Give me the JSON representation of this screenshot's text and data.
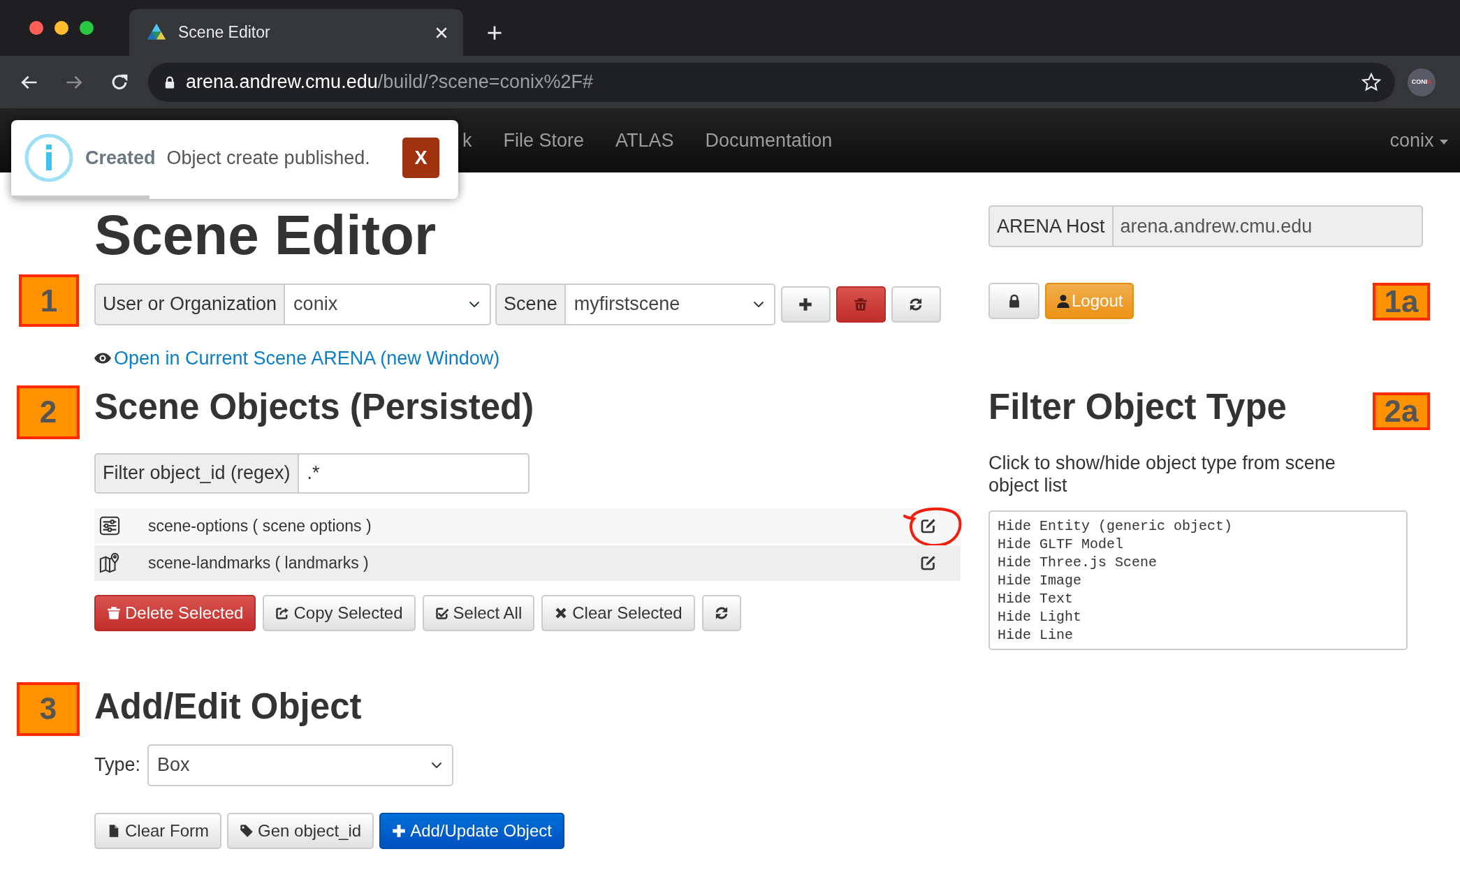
{
  "browser": {
    "tab_title": "Scene Editor",
    "url_host": "arena.andrew.cmu.edu",
    "url_path": "/build/?scene=conix%2F#",
    "avatar_text": "CONI",
    "avatar_accent": "X"
  },
  "navbar": {
    "items": [
      {
        "label": "k"
      },
      {
        "label": "File Store"
      },
      {
        "label": "ATLAS"
      },
      {
        "label": "Documentation"
      }
    ],
    "user": "conix"
  },
  "toast": {
    "title": "Created",
    "message": "Object create published.",
    "close": "X",
    "level": 0.31
  },
  "page_title": "Scene Editor",
  "scene_selector": {
    "marker": "1",
    "user_label": "User or Organization",
    "user_value": "conix",
    "scene_label": "Scene",
    "scene_value": "myfirstscene"
  },
  "host": {
    "label": "ARENA Host",
    "value": "arena.andrew.cmu.edu",
    "disabled": true
  },
  "account": {
    "marker": "1a",
    "logout": "Logout"
  },
  "open_link": "Open in Current Scene ARENA (new Window)",
  "scene_objects": {
    "marker": "2",
    "heading": "Scene Objects (Persisted)",
    "filter_label": "Filter object_id (regex)",
    "filter_value": ".*",
    "objects": [
      {
        "kind": "options",
        "label": "scene-options ( scene options )",
        "annotated": true
      },
      {
        "kind": "landmarks",
        "label": "scene-landmarks ( landmarks )",
        "annotated": false
      }
    ],
    "buttons": [
      {
        "kind": "delete",
        "label": "Delete Selected"
      },
      {
        "kind": "copy",
        "label": "Copy Selected"
      },
      {
        "kind": "select",
        "label": "Select All"
      },
      {
        "kind": "clear",
        "label": "Clear Selected"
      },
      {
        "kind": "refresh"
      }
    ]
  },
  "filter_types": {
    "marker": "2a",
    "heading": "Filter Object Type",
    "description": "Click to show/hide object type from scene object list",
    "options": [
      "Hide Entity (generic object)",
      "Hide GLTF Model",
      "Hide Three.js Scene",
      "Hide Image",
      "Hide Text",
      "Hide Light",
      "Hide Line"
    ]
  },
  "add_edit": {
    "marker": "3",
    "heading": "Add/Edit Object",
    "type_label": "Type:",
    "type_value": "Box",
    "buttons": [
      {
        "kind": "clear",
        "label": "Clear Form"
      },
      {
        "kind": "gen",
        "label": "Gen object_id"
      },
      {
        "kind": "add",
        "label": "Add/Update Object"
      }
    ]
  }
}
